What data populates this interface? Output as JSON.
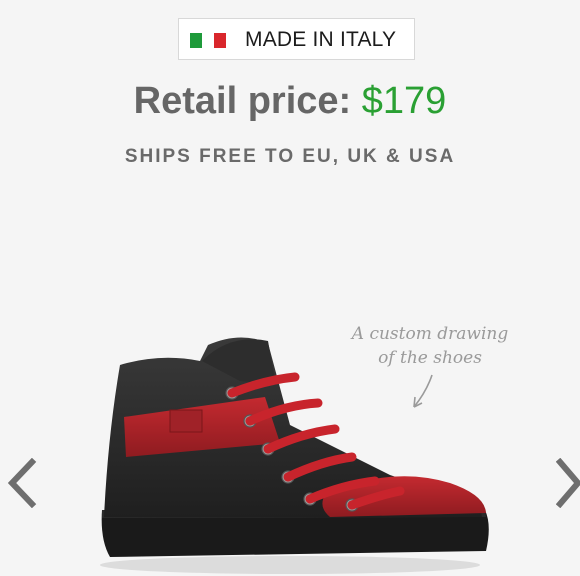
{
  "badge": {
    "text": "MADE IN ITALY",
    "flag": "italy-flag",
    "flag_colors": [
      "#1e9a3a",
      "#ffffff",
      "#d9262c"
    ]
  },
  "price": {
    "label": "Retail price:",
    "amount": "$179",
    "amount_color": "#2aa033"
  },
  "shipping": "SHIPS FREE TO EU, UK & USA",
  "note": {
    "line1": "A custom drawing",
    "line2": "of the shoes"
  },
  "nav": {
    "prev_icon": "chevron-left-icon",
    "next_icon": "chevron-right-icon"
  },
  "product": {
    "image": "shoe-illustration",
    "colors": {
      "upper": "#2b2b2b",
      "accent": "#b8252b",
      "laces": "#c8242c"
    }
  }
}
